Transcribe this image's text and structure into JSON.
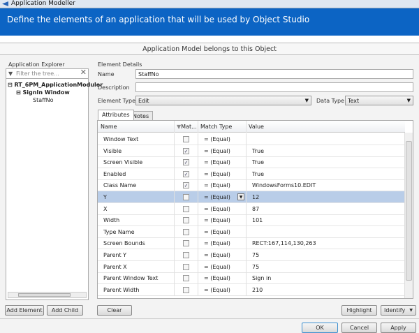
{
  "window": {
    "title": "Application Modeller",
    "banner": "Define the elements of an application that will be used by Object Studio",
    "model_bar": "Application Model belongs to this Object"
  },
  "explorer": {
    "label": "Application Explorer",
    "filter_placeholder": "Filter the tree...",
    "tree": [
      "RT_6PM_ApplicationModuler",
      "SignIn Window",
      "StaffNo"
    ],
    "add_element": "Add Element",
    "add_child": "Add Child"
  },
  "details": {
    "label": "Element Details",
    "name_label": "Name",
    "name_value": "StaffNo",
    "description_label": "Description",
    "description_value": "",
    "element_type_label": "Element Type",
    "element_type_value": "Edit",
    "data_type_label": "Data Type",
    "data_type_value": "Text"
  },
  "tabs": [
    "Attributes",
    "Notes"
  ],
  "table": {
    "headers": [
      "Name",
      "Mat...",
      "Match Type",
      "Value"
    ],
    "rows": [
      {
        "name": "Window Text",
        "match": false,
        "type": "= (Equal)",
        "value": ""
      },
      {
        "name": "Visible",
        "match": true,
        "type": "= (Equal)",
        "value": "True"
      },
      {
        "name": "Screen Visible",
        "match": true,
        "type": "= (Equal)",
        "value": "True"
      },
      {
        "name": "Enabled",
        "match": true,
        "type": "= (Equal)",
        "value": "True"
      },
      {
        "name": "Class Name",
        "match": true,
        "type": "= (Equal)",
        "value": "WindowsForms10.EDIT"
      },
      {
        "name": "Y",
        "match": false,
        "type": "= (Equal)",
        "value": "12",
        "selected": true
      },
      {
        "name": "X",
        "match": false,
        "type": "= (Equal)",
        "value": "87"
      },
      {
        "name": "Width",
        "match": false,
        "type": "= (Equal)",
        "value": "101"
      },
      {
        "name": "Type Name",
        "match": false,
        "type": "= (Equal)",
        "value": ""
      },
      {
        "name": "Screen Bounds",
        "match": false,
        "type": "= (Equal)",
        "value": "RECT:167,114,130,263"
      },
      {
        "name": "Parent Y",
        "match": false,
        "type": "= (Equal)",
        "value": "75"
      },
      {
        "name": "Parent X",
        "match": false,
        "type": "= (Equal)",
        "value": "75"
      },
      {
        "name": "Parent Window Text",
        "match": false,
        "type": "= (Equal)",
        "value": "Sign in"
      },
      {
        "name": "Parent Width",
        "match": false,
        "type": "= (Equal)",
        "value": "210"
      }
    ]
  },
  "buttons": {
    "clear": "Clear",
    "highlight": "Highlight",
    "identify": "Identify",
    "ok": "OK",
    "cancel": "Cancel",
    "apply": "Apply"
  },
  "colors": {
    "banner": "#0c64c4",
    "selected_row": "#b9cde8"
  }
}
